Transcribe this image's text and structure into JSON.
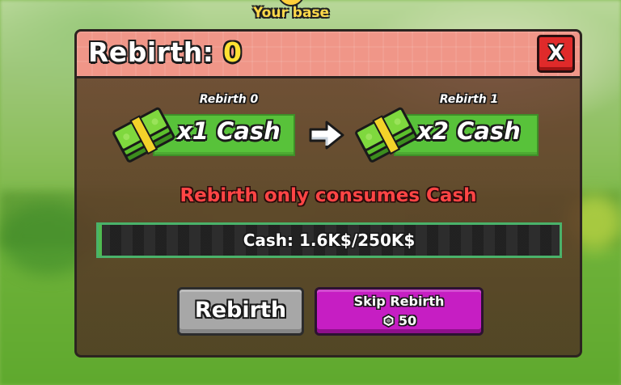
{
  "world": {
    "location_label": "Your base"
  },
  "dialog": {
    "title": "Rebirth:",
    "rebirth_count": "0",
    "close_label": "X",
    "current": {
      "label": "Rebirth 0",
      "multiplier": "x1 Cash",
      "icon": "money-stack-icon"
    },
    "next": {
      "label": "Rebirth 1",
      "multiplier": "x2 Cash",
      "icon": "money-stack-icon"
    },
    "arrow_icon": "arrow-right-icon",
    "warning": "Rebirth only consumes Cash",
    "progress": {
      "text": "Cash: 1.6K$/250K$",
      "fraction": 0.0064
    },
    "rebirth_button_label": "Rebirth",
    "skip_button": {
      "label": "Skip Rebirth",
      "price": "50",
      "currency_icon": "robux-icon"
    }
  },
  "colors": {
    "title_bar": "#f09688",
    "count": "#ffe233",
    "close": "#e02a2a",
    "cash_green": "#58c23a",
    "warning_red": "#ff4545",
    "progress_border": "#4ab26a",
    "rebirth_gray": "#a7a7a7",
    "skip_purple": "#c61ec3"
  }
}
